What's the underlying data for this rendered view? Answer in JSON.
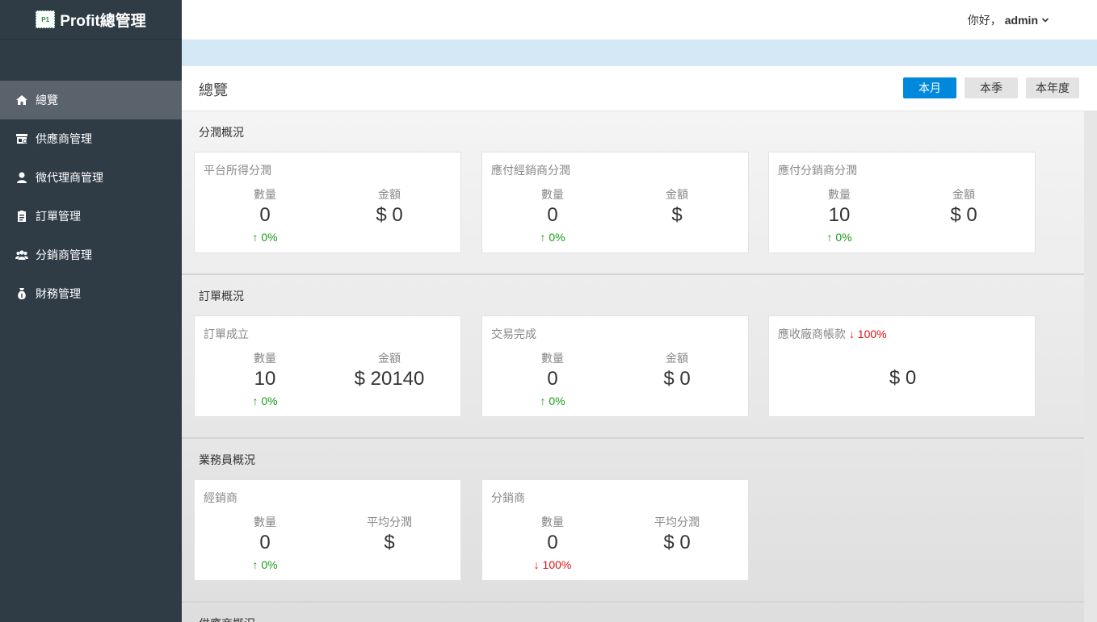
{
  "brand": {
    "logo_text": "P1",
    "title": "Profit總管理"
  },
  "sidebar": {
    "items": [
      {
        "label": "總覽",
        "icon": "home-icon",
        "active": true
      },
      {
        "label": "供應商管理",
        "icon": "store-icon",
        "active": false
      },
      {
        "label": "微代理商管理",
        "icon": "user-icon",
        "active": false
      },
      {
        "label": "訂單管理",
        "icon": "clipboard-icon",
        "active": false
      },
      {
        "label": "分銷商管理",
        "icon": "users-icon",
        "active": false
      },
      {
        "label": "財務管理",
        "icon": "money-bag-icon",
        "active": false
      }
    ]
  },
  "header": {
    "greeting": "你好，",
    "username": "admin"
  },
  "titlebar": {
    "title": "總覽",
    "periods": [
      "本月",
      "本季",
      "本年度"
    ],
    "active_period": "本月"
  },
  "sections": [
    {
      "title": "分潤概況",
      "cards": [
        {
          "title": "平台所得分潤",
          "cols": [
            {
              "label": "數量",
              "value": "0",
              "change": "↑ 0%",
              "dir": "up"
            },
            {
              "label": "金額",
              "value": "$ 0"
            }
          ]
        },
        {
          "title": "應付經銷商分潤",
          "cols": [
            {
              "label": "數量",
              "value": "0",
              "change": "↑ 0%",
              "dir": "up"
            },
            {
              "label": "金額",
              "value": "$"
            }
          ]
        },
        {
          "title": "應付分銷商分潤",
          "cols": [
            {
              "label": "數量",
              "value": "10",
              "change": "↑ 0%",
              "dir": "up"
            },
            {
              "label": "金額",
              "value": "$ 0"
            }
          ]
        }
      ]
    },
    {
      "title": "訂單概況",
      "cards": [
        {
          "title": "訂單成立",
          "cols": [
            {
              "label": "數量",
              "value": "10",
              "change": "↑ 0%",
              "dir": "up"
            },
            {
              "label": "金額",
              "value": "$ 20140"
            }
          ]
        },
        {
          "title": "交易完成",
          "cols": [
            {
              "label": "數量",
              "value": "0",
              "change": "↑ 0%",
              "dir": "up"
            },
            {
              "label": "金額",
              "value": "$ 0"
            }
          ]
        },
        {
          "title": "應收廠商帳款",
          "title_change": "↓ 100%",
          "value": "$ 0"
        }
      ]
    },
    {
      "title": "業務員概況",
      "cards": [
        {
          "title": "經銷商",
          "cols": [
            {
              "label": "數量",
              "value": "0",
              "change": "↑ 0%",
              "dir": "up"
            },
            {
              "label": "平均分潤",
              "value": "$"
            }
          ]
        },
        {
          "title": "分銷商",
          "cols": [
            {
              "label": "數量",
              "value": "0",
              "change": "↓ 100%",
              "dir": "down"
            },
            {
              "label": "平均分潤",
              "value": "$ 0"
            }
          ]
        }
      ]
    },
    {
      "title": "供應商概況"
    }
  ],
  "colors": {
    "sidebar_bg": "#2f3b45",
    "active_item_bg": "#5a636b",
    "accent": "#0088dd",
    "up": "#1a9a1a",
    "down": "#e01010"
  }
}
